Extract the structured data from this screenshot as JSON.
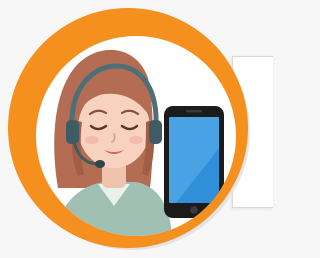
{
  "icons": {
    "avatar": "support-agent-icon",
    "phone": "smartphone-icon"
  },
  "colors": {
    "ring": "#f58f1e",
    "hair": "#b46c52",
    "skin": "#f7d3bf",
    "shirt": "#9fc0b3",
    "headset": "#4d6f78",
    "phone_body": "#1b1b1b",
    "phone_screen": "#2f8fd8"
  }
}
